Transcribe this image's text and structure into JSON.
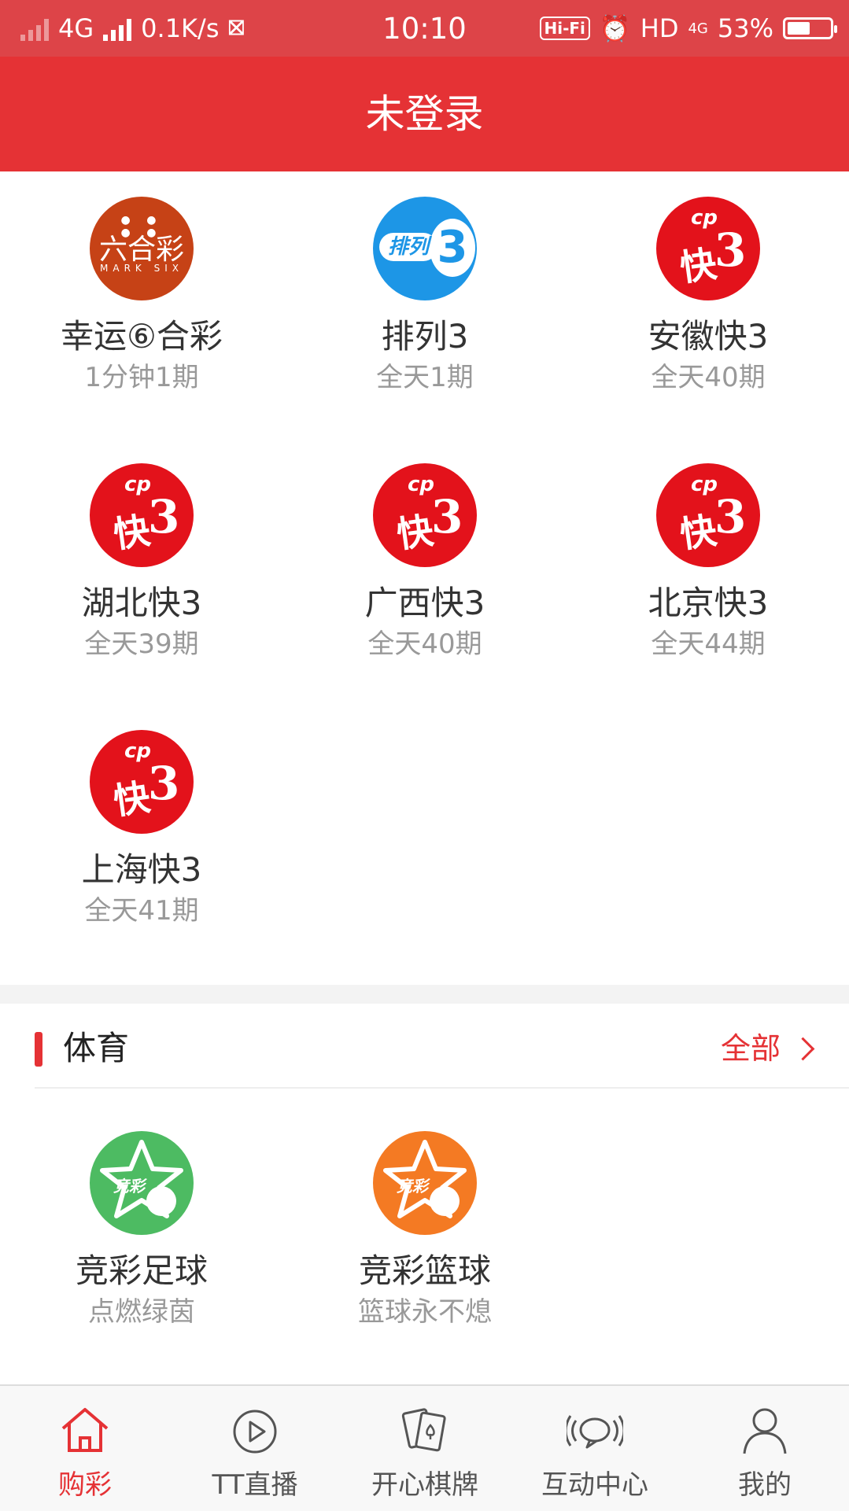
{
  "status_bar": {
    "network": "4G",
    "speed": "0.1K/s",
    "time": "10:10",
    "hifi": "Hi-Fi",
    "hd": "HD",
    "net2": "4G",
    "battery": "53%",
    "battery_level": 0.53
  },
  "header": {
    "title": "未登录"
  },
  "lotteries": [
    {
      "name": "幸运⑥合彩",
      "sub": "1分钟1期",
      "icon": "mark-six-icon",
      "logo_text": "六合彩",
      "logo_sub": "MARK SIX"
    },
    {
      "name": "排列3",
      "sub": "全天1期",
      "icon": "pailie3-icon",
      "logo_text": "排列",
      "logo_num": "3"
    },
    {
      "name": "安徽快3",
      "sub": "全天40期",
      "icon": "kuai3-icon",
      "logo_text": "快",
      "logo_num": "3"
    },
    {
      "name": "湖北快3",
      "sub": "全天39期",
      "icon": "kuai3-icon",
      "logo_text": "快",
      "logo_num": "3"
    },
    {
      "name": "广西快3",
      "sub": "全天40期",
      "icon": "kuai3-icon",
      "logo_text": "快",
      "logo_num": "3"
    },
    {
      "name": "北京快3",
      "sub": "全天44期",
      "icon": "kuai3-icon",
      "logo_text": "快",
      "logo_num": "3"
    },
    {
      "name": "上海快3",
      "sub": "全天41期",
      "icon": "kuai3-icon",
      "logo_text": "快",
      "logo_num": "3"
    }
  ],
  "sports": {
    "title": "体育",
    "more": "全部",
    "items": [
      {
        "name": "竞彩足球",
        "sub": "点燃绿茵",
        "icon": "football-star-icon",
        "logo_text": "竞彩"
      },
      {
        "name": "竞彩篮球",
        "sub": "篮球永不熄",
        "icon": "basketball-star-icon",
        "logo_text": "竞彩"
      }
    ]
  },
  "tabs": [
    {
      "label": "购彩",
      "icon": "home-icon",
      "active": true
    },
    {
      "label": "TT直播",
      "icon": "play-icon",
      "active": false
    },
    {
      "label": "开心棋牌",
      "icon": "cards-icon",
      "active": false
    },
    {
      "label": "互动中心",
      "icon": "chat-bubble-icon",
      "active": false
    },
    {
      "label": "我的",
      "icon": "user-icon",
      "active": false
    }
  ],
  "colors": {
    "brand_red": "#e53235",
    "status_red": "#dd4448",
    "kuai3_red": "#e3121b",
    "marksix_orange": "#c64216",
    "pailie_blue": "#1d96e6",
    "football_green": "#4dbb62",
    "basketball_orange": "#f47a23"
  }
}
